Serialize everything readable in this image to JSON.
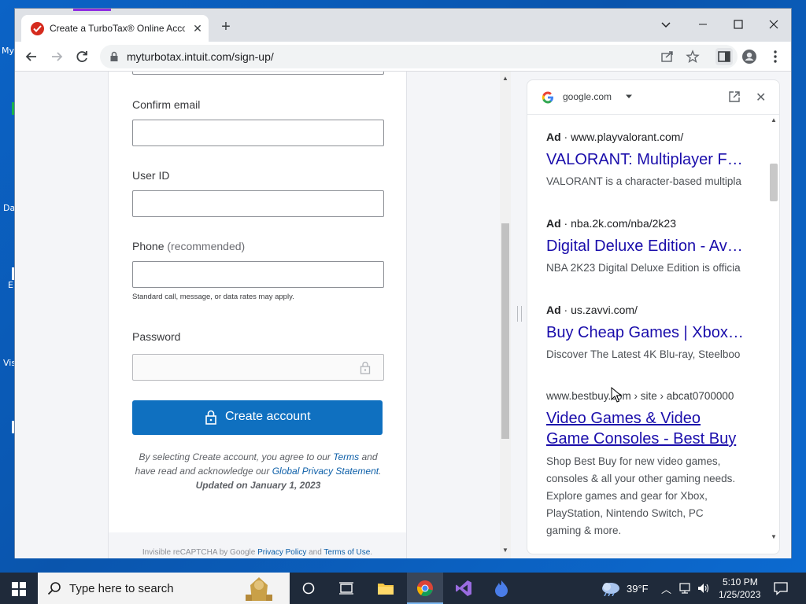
{
  "desktop": {
    "fragments": [
      "My",
      "Da",
      "E",
      "Vis"
    ]
  },
  "browser": {
    "tab_title": "Create a TurboTax® Online Acco",
    "new_tab": "+",
    "url": "myturbotax.intuit.com/sign-up/"
  },
  "form": {
    "confirm_email_label": "Confirm email",
    "user_id_label": "User ID",
    "phone_label": "Phone",
    "phone_hint": "(recommended)",
    "phone_note": "Standard call, message, or data rates may apply.",
    "password_label": "Password",
    "create_button": "Create account",
    "legal_1": "By selecting Create account, you agree to our ",
    "terms_link": "Terms",
    "legal_2": " and have read and acknowledge our ",
    "privacy_link": "Global Privacy Statement",
    "legal_3": ".",
    "updated": "Updated on January 1, 2023",
    "recaptcha_1": "Invisible reCAPTCHA by Google ",
    "recaptcha_privacy": "Privacy Policy",
    "recaptcha_and": " and ",
    "recaptcha_terms": "Terms of Use",
    "recaptcha_end": "."
  },
  "side_panel": {
    "domain": "google.com",
    "results": [
      {
        "ad": "Ad",
        "url": "www.playvalorant.com/",
        "title": "VALORANT: Multiplayer F…",
        "desc": "VALORANT is a character-based multipla"
      },
      {
        "ad": "Ad",
        "url": "nba.2k.com/nba/2k23",
        "title": "Digital Deluxe Edition - Av…",
        "desc": "NBA 2K23 Digital Deluxe Edition is officia"
      },
      {
        "ad": "Ad",
        "url": "us.zavvi.com/",
        "title": "Buy Cheap Games | Xbox…",
        "desc": "Discover The Latest 4K Blu-ray, Steelboo"
      },
      {
        "url": "www.bestbuy.com › site › abcat0700000",
        "title_line1": "Video Games & Video",
        "title_line2": "Game Consoles - Best Buy",
        "desc_lines": [
          "Shop Best Buy for new video games,",
          "consoles & all your other gaming needs.",
          "Explore games and gear for Xbox,",
          "PlayStation, Nintendo Switch, PC",
          "gaming & more."
        ]
      }
    ]
  },
  "taskbar": {
    "search_placeholder": "Type here to search",
    "temperature": "39°F",
    "time": "5:10 PM",
    "date": "1/25/2023"
  }
}
